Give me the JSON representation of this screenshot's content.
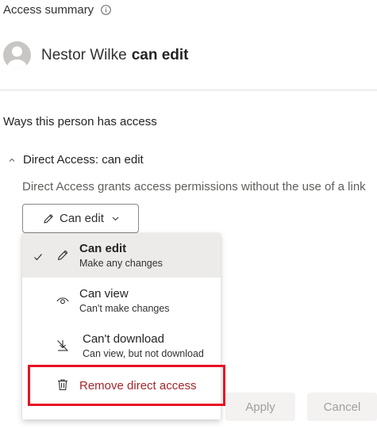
{
  "header": {
    "access_summary_label": "Access summary",
    "user_name": "Nestor Wilke",
    "user_permission": "can edit"
  },
  "section": {
    "ways_title": "Ways this person has access",
    "direct_access_label": "Direct Access: can edit",
    "direct_access_desc": "Direct Access grants access permissions without the use of a link"
  },
  "dropdown": {
    "selected_label": "Can edit"
  },
  "menu": {
    "items": [
      {
        "title": "Can edit",
        "subtitle": "Make any changes",
        "icon": "pencil-icon",
        "selected": true
      },
      {
        "title": "Can view",
        "subtitle": "Can't make changes",
        "icon": "eye-icon",
        "selected": false
      },
      {
        "title": "Can't download",
        "subtitle": "Can view, but not download",
        "icon": "no-download-icon",
        "selected": false
      }
    ],
    "remove_label": "Remove direct access",
    "remove_icon": "trash-icon"
  },
  "buttons": {
    "apply": "Apply",
    "cancel": "Cancel"
  },
  "colors": {
    "danger": "#a4262c",
    "highlight": "#e81123",
    "selected_bg": "#edebe9",
    "disabled_text": "#a19f9d"
  }
}
